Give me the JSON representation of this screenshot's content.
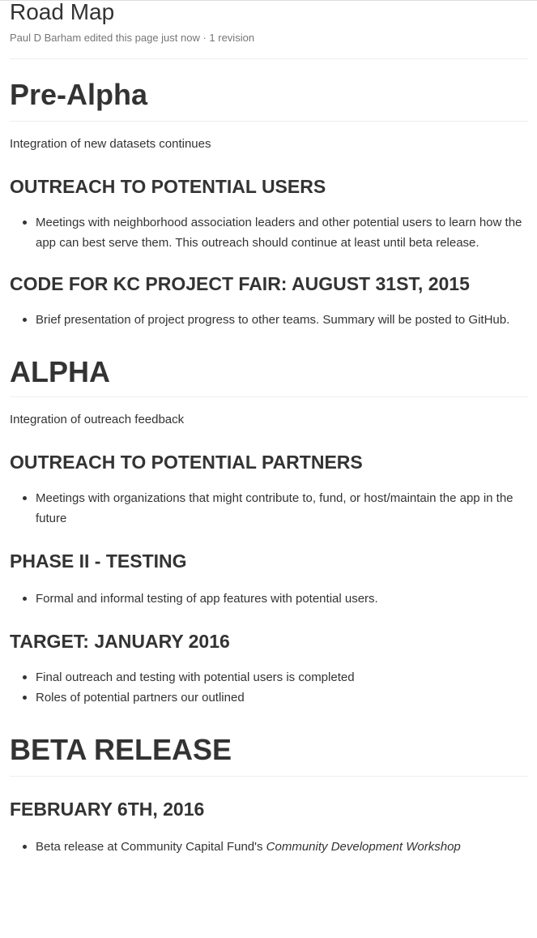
{
  "page": {
    "title": "Road Map",
    "meta": "Paul D Barham edited this page just now · 1 revision"
  },
  "sections": {
    "pre_alpha": {
      "heading": "Pre-Alpha",
      "lead": "Integration of new datasets continues",
      "outreach_users": {
        "heading": "OUTREACH TO POTENTIAL USERS",
        "items": [
          "Meetings with neighborhood association leaders and other potential users to learn how the app can best serve them. This outreach should continue at least until beta release."
        ]
      },
      "codekc": {
        "heading": "CODE FOR KC PROJECT FAIR: AUGUST 31ST, 2015",
        "items": [
          "Brief presentation of project progress to other teams. Summary will be posted to GitHub."
        ]
      }
    },
    "alpha": {
      "heading": "ALPHA",
      "lead": "Integration of outreach feedback",
      "outreach_partners": {
        "heading": "OUTREACH TO POTENTIAL PARTNERS",
        "items": [
          "Meetings with organizations that might contribute to, fund, or host/maintain the app in the future"
        ]
      },
      "phase2": {
        "heading": "PHASE II - TESTING",
        "items": [
          "Formal and informal testing of app features with potential users."
        ]
      },
      "target": {
        "heading": "TARGET: JANUARY 2016",
        "items": [
          "Final outreach and testing with potential users is completed",
          "Roles of potential partners our outlined"
        ]
      }
    },
    "beta": {
      "heading": "BETA RELEASE",
      "feb": {
        "heading": "FEBRUARY 6TH, 2016",
        "item_prefix": "Beta release at Community Capital Fund's ",
        "item_emphasis": "Community Development Workshop"
      }
    }
  }
}
